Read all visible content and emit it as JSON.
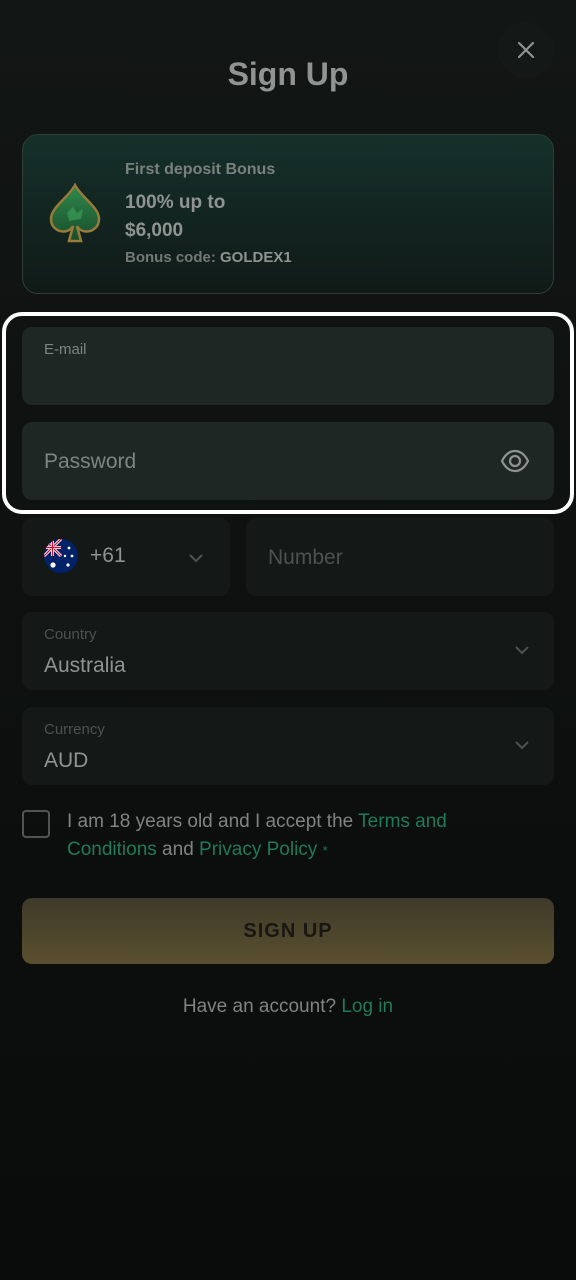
{
  "header": {
    "title": "Sign Up"
  },
  "bonus": {
    "caption": "First deposit Bonus",
    "amount_line1": "100% up to",
    "amount_line2": "$6,000",
    "code_label": "Bonus code:",
    "code_value": "GOLDEX1"
  },
  "form": {
    "email_label": "E-mail",
    "password_placeholder": "Password",
    "phone_code": "+61",
    "phone_placeholder": "Number",
    "country_label": "Country",
    "country_value": "Australia",
    "currency_label": "Currency",
    "currency_value": "AUD"
  },
  "terms": {
    "prefix": "I am 18 years old and I accept the ",
    "terms_link": "Terms and Conditions",
    "middle": " and ",
    "privacy_link": "Privacy Policy",
    "required_mark": "*"
  },
  "actions": {
    "signup_label": "SIGN UP",
    "login_prompt": "Have an account? ",
    "login_link": "Log in"
  },
  "icons": {
    "close": "close-icon",
    "bonus": "spade-icon",
    "eye": "eye-icon",
    "chevron": "chevron-down-icon",
    "flag": "australia-flag-icon"
  },
  "colors": {
    "accent_green": "#1f7a57",
    "button_gold": "#5a4f2e",
    "highlight": "#ffffff"
  }
}
